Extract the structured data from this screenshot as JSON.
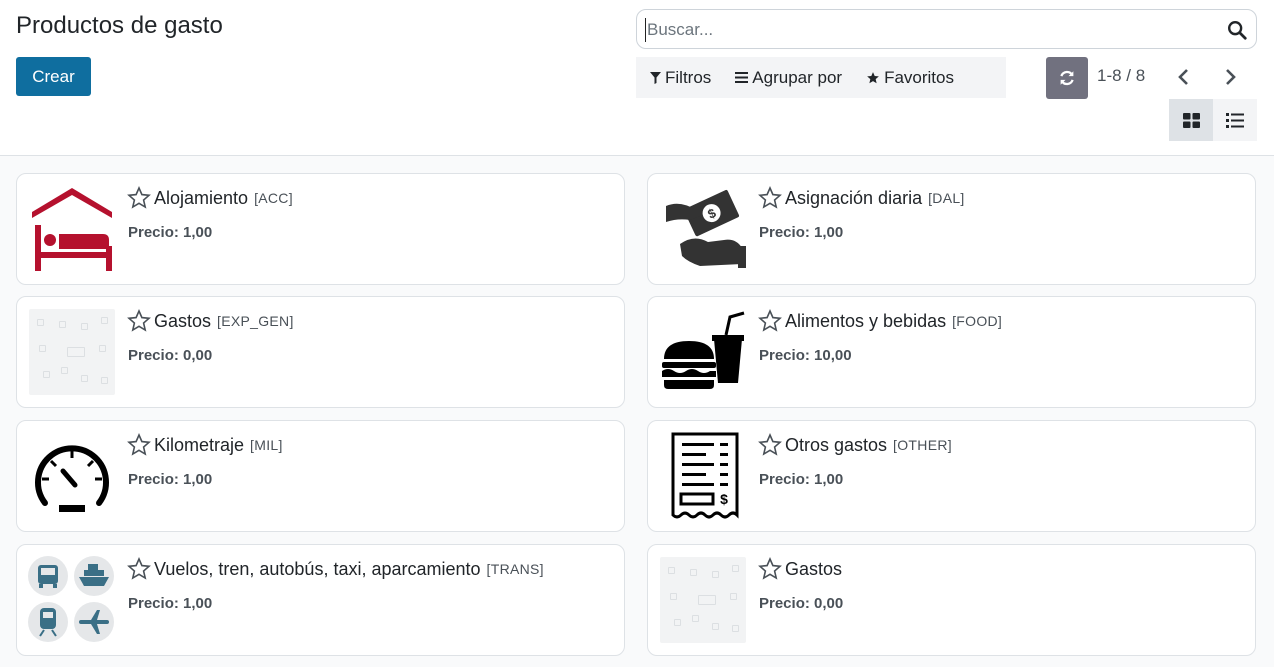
{
  "header": {
    "title": "Productos de gasto",
    "create_label": "Crear",
    "search_placeholder": "Buscar...",
    "filters_label": "Filtros",
    "groupby_label": "Agrupar por",
    "favorites_label": "Favoritos",
    "pager": "1-8 / 8"
  },
  "products": [
    {
      "name": "Alojamiento",
      "code": "[ACC]",
      "price": "Precio: 1,00",
      "icon": "hotel-bed-icon"
    },
    {
      "name": "Asignación diaria",
      "code": "[DAL]",
      "price": "Precio: 1,00",
      "icon": "money-hand-icon"
    },
    {
      "name": "Gastos",
      "code": "[EXP_GEN]",
      "price": "Precio: 0,00",
      "icon": "placeholder-image-icon"
    },
    {
      "name": "Alimentos y bebidas",
      "code": "[FOOD]",
      "price": "Precio: 10,00",
      "icon": "burger-drink-icon"
    },
    {
      "name": "Kilometraje",
      "code": "[MIL]",
      "price": "Precio: 1,00",
      "icon": "speedometer-icon"
    },
    {
      "name": "Otros gastos",
      "code": "[OTHER]",
      "price": "Precio: 1,00",
      "icon": "receipt-icon"
    },
    {
      "name": "Vuelos, tren, autobús, taxi, aparcamiento",
      "code": "[TRANS]",
      "price": "Precio: 1,00",
      "icon": "transport-icons"
    },
    {
      "name": "Gastos",
      "code": "",
      "price": "Precio: 0,00",
      "icon": "placeholder-image-icon"
    }
  ],
  "colors": {
    "primary": "#0f6e9f",
    "hotel_red": "#b5112e",
    "transport_teal": "#3a6f86"
  }
}
